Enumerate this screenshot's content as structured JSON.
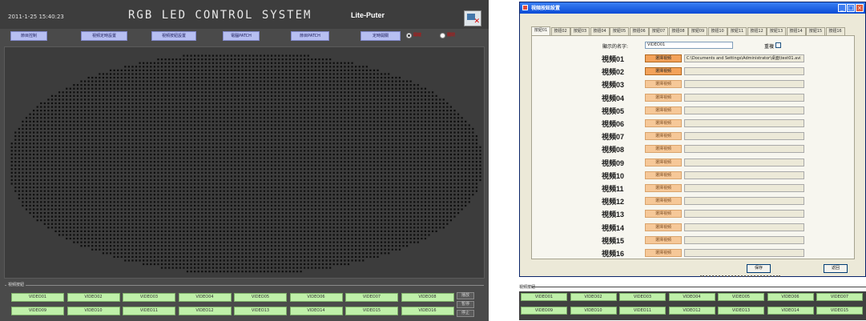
{
  "left": {
    "datetime": "2011-1-25 15:40:23",
    "title": "RGB LED CONTROL SYSTEM",
    "brand": "Lite-Puter",
    "nav": [
      "節目控制",
      "視頻定時設置",
      "視頻按鈕設置",
      "電腦PATCH",
      "節目PATCH",
      "定時開關"
    ],
    "radios": [
      {
        "label": "開啟",
        "selected": true
      },
      {
        "label": "關閉",
        "selected": false
      }
    ],
    "dot_color": "#0d0d0d",
    "canvas_bg": "#3c3c3c",
    "section_label": "視頻按鈕",
    "videos_row1": [
      "VIDEO01",
      "VIDEO02",
      "VIDEO03",
      "VIDEO04",
      "VIDEO05",
      "VIDEO06",
      "VIDEO07",
      "VIDEO08"
    ],
    "videos_row2": [
      "VIDEO09",
      "VIDEO10",
      "VIDEO11",
      "VIDEO12",
      "VIDEO13",
      "VIDEO14",
      "VIDEO15",
      "VIDEO16"
    ],
    "controls": [
      "播放",
      "暫停",
      "停止"
    ]
  },
  "right": {
    "window_title": "視頻按鈕設置",
    "tabs": [
      "按鈕01",
      "按鈕02",
      "按鈕03",
      "按鈕04",
      "按鈕05",
      "按鈕06",
      "按鈕07",
      "按鈕08",
      "按鈕09",
      "按鈕10",
      "按鈕11",
      "按鈕12",
      "按鈕13",
      "按鈕14",
      "按鈕15",
      "按鈕16"
    ],
    "name_label": "顯示的名字:",
    "name_value": "VIDEO01",
    "loop_label": "重複",
    "select_label": "選擇視頻",
    "video_rows": [
      {
        "label": "視頻01",
        "path": "C:\\Documents and Settings\\Administrator\\桌面\\test01.avi"
      },
      {
        "label": "視頻02",
        "path": ""
      },
      {
        "label": "視頻03",
        "path": ""
      },
      {
        "label": "視頻04",
        "path": ""
      },
      {
        "label": "視頻05",
        "path": ""
      },
      {
        "label": "視頻06",
        "path": ""
      },
      {
        "label": "視頻07",
        "path": ""
      },
      {
        "label": "視頻08",
        "path": ""
      },
      {
        "label": "視頻09",
        "path": ""
      },
      {
        "label": "視頻10",
        "path": ""
      },
      {
        "label": "視頻11",
        "path": ""
      },
      {
        "label": "視頻12",
        "path": ""
      },
      {
        "label": "視頻13",
        "path": ""
      },
      {
        "label": "視頻14",
        "path": ""
      },
      {
        "label": "視頻15",
        "path": ""
      },
      {
        "label": "視頻16",
        "path": ""
      }
    ],
    "save_label": "保存",
    "back_label": "返回",
    "section_label": "視頻按鈕",
    "videos_row1": [
      "VIDEO01",
      "VIDEO02",
      "VIDEO03",
      "VIDEO04",
      "VIDEO05",
      "VIDEO06",
      "VIDEO07"
    ],
    "videos_row2": [
      "VIDEO09",
      "VIDEO10",
      "VIDEO11",
      "VIDEO12",
      "VIDEO13",
      "VIDEO14",
      "VIDEO15"
    ]
  }
}
